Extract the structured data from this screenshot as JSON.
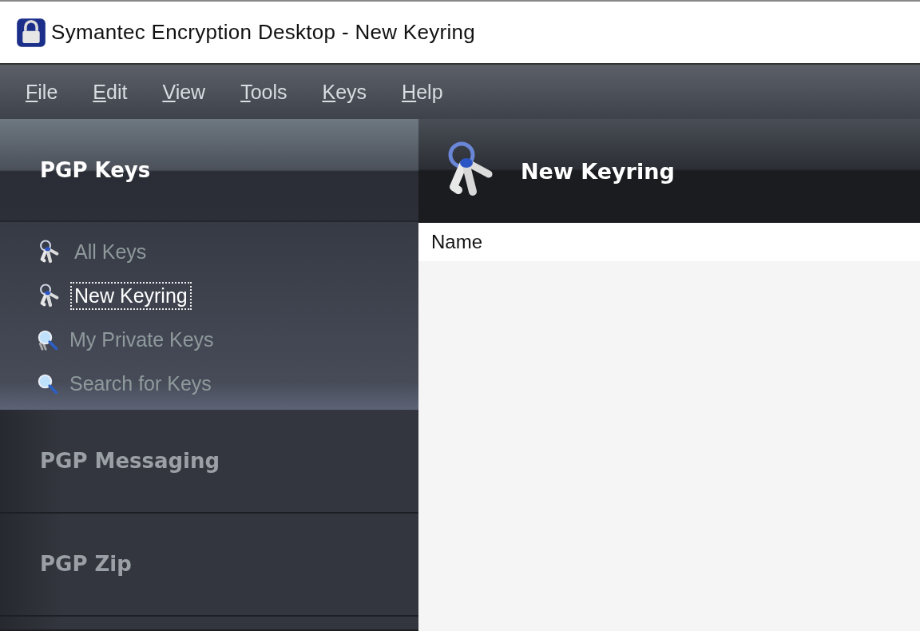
{
  "window": {
    "title": "Symantec Encryption Desktop - New Keyring"
  },
  "menu": [
    "File",
    "Edit",
    "View",
    "Tools",
    "Keys",
    "Help"
  ],
  "sidebar": {
    "sections": [
      {
        "label": "PGP Keys",
        "expanded": true,
        "items": [
          {
            "label": "All Keys",
            "kind": "keyring",
            "selected": false
          },
          {
            "label": "New Keyring",
            "kind": "keyring",
            "selected": true
          },
          {
            "label": "My Private Keys",
            "kind": "private",
            "selected": false
          },
          {
            "label": "Search for Keys",
            "kind": "search",
            "selected": false
          }
        ]
      },
      {
        "label": "PGP Messaging",
        "expanded": false
      },
      {
        "label": "PGP Zip",
        "expanded": false
      }
    ]
  },
  "content": {
    "title": "New Keyring",
    "table": {
      "columns": [
        "Name"
      ]
    }
  }
}
